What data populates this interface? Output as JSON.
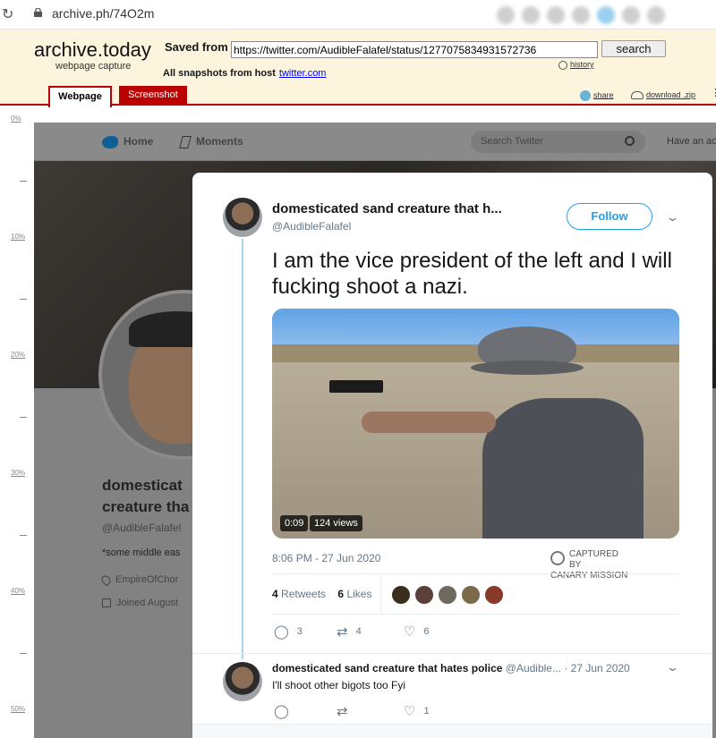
{
  "browser": {
    "url": "archive.ph/74O2m"
  },
  "archive": {
    "logo": "archive.today",
    "logo_sub": "webpage capture",
    "saved_from_label": "Saved from",
    "saved_url": "https://twitter.com/AudibleFalafel/status/1277075834931572736",
    "search_label": "search",
    "history_label": "history",
    "all_snapshots_label": "All snapshots  from host",
    "host_link": "twitter.com",
    "tabs": [
      {
        "label": "Webpage",
        "active": true
      },
      {
        "label": "Screenshot",
        "active": false
      }
    ],
    "share_label": "share",
    "download_label": "download .zip",
    "accent_color": "#bb0000",
    "header_bg": "#fcf4dc"
  },
  "ruler": {
    "marks": [
      "0%",
      "10%",
      "20%",
      "30%",
      "40%",
      "50%"
    ]
  },
  "twitter_bg": {
    "nav": [
      {
        "label": "Home",
        "icon": "bird-icon"
      },
      {
        "label": "Moments",
        "icon": "lightning-icon"
      }
    ],
    "search_placeholder": "Search Twitter",
    "have_account": "Have an ac",
    "profile_name": "domesticat creature tha",
    "profile_handle": "@AudibleFalafel",
    "profile_bio": "*some middle eas",
    "profile_location": "EmpireOfChor",
    "profile_joined": "Joined August"
  },
  "tweet": {
    "author_name": "domesticated sand creature that h...",
    "author_handle": "@AudibleFalafel",
    "follow_label": "Follow",
    "text": "I am the vice president of the left and I will fucking shoot a nazi.",
    "video_duration": "0:09",
    "video_views": "124 views",
    "timestamp": "8:06 PM - 27 Jun 2020",
    "captured_by": "CAPTURED BY",
    "captured_org": "CANARY MISSION",
    "retweets_count": "4",
    "retweets_label": "Retweets",
    "likes_count": "6",
    "likes_label": "Likes",
    "actions": {
      "replies": "3",
      "retweets": "4",
      "likes": "6"
    },
    "accent_color": "#1da1f2"
  },
  "reply": {
    "author_name": "domesticated sand creature that hates police",
    "author_handle": "@Audible...",
    "date": "· 27 Jun 2020",
    "text": "I'll shoot other bigots too Fyi",
    "actions": {
      "replies": "",
      "retweets": "",
      "likes": "1"
    }
  }
}
